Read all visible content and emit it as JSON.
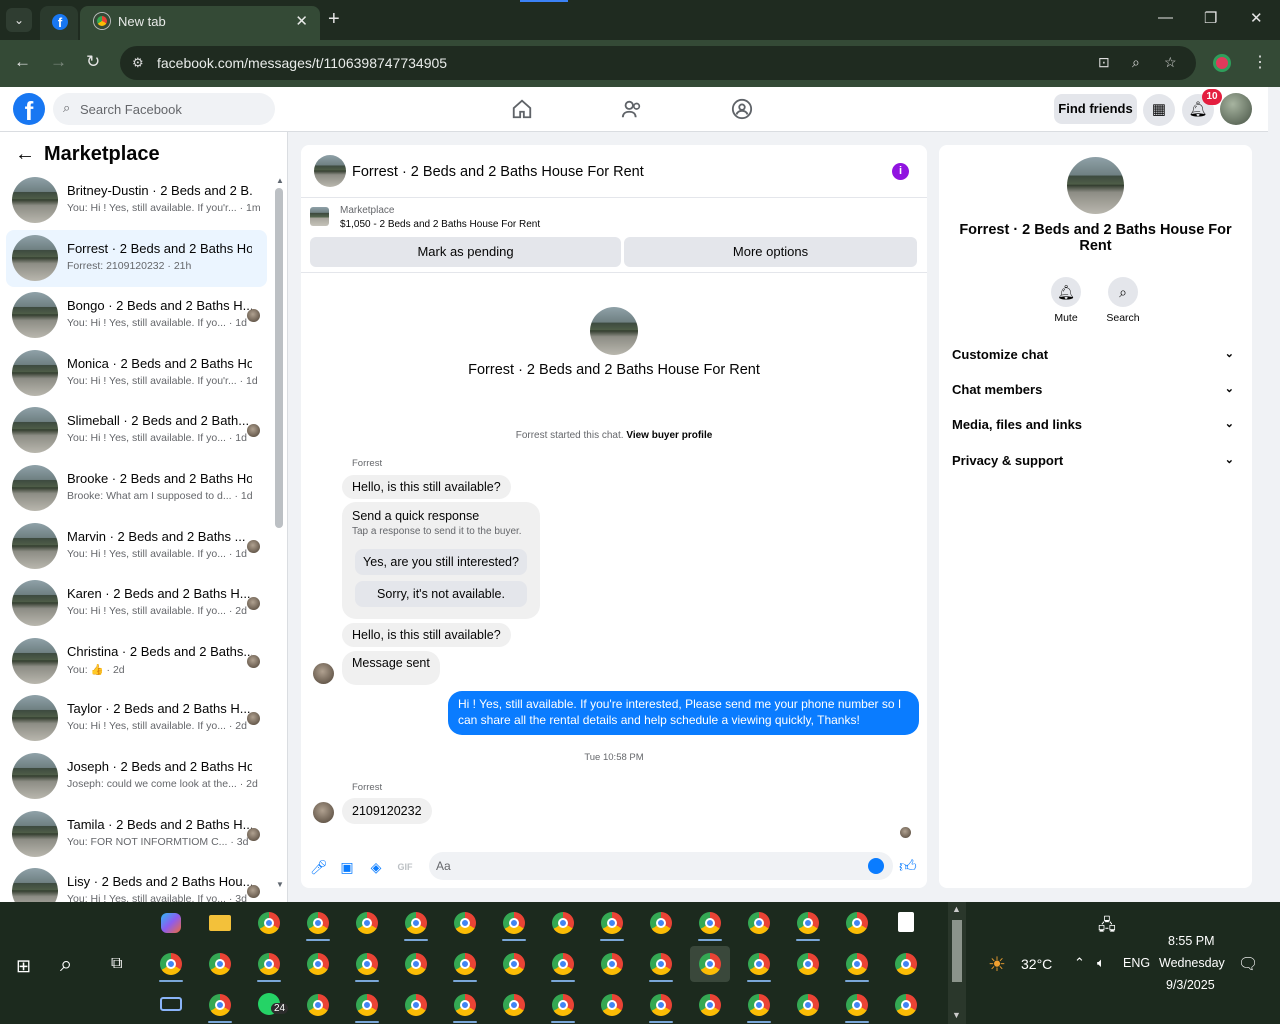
{
  "browser": {
    "tabs": [
      {
        "label": "",
        "icon": "facebook-icon"
      },
      {
        "label": "New tab",
        "icon": "chrome-icon"
      }
    ],
    "url": "facebook.com/messages/t/1106398747734905"
  },
  "fb_nav": {
    "search_placeholder": "Search Facebook",
    "find_friends": "Find friends",
    "notifications_count": "10"
  },
  "left_panel": {
    "title": "Marketplace",
    "conversations": [
      {
        "name": "Britney-Dustin · 2 Beds and 2 B...",
        "preview": "You: Hi ! Yes, still available. If you'r... · 1m"
      },
      {
        "name": "Forrest · 2 Beds and 2 Baths Ho...",
        "preview": "Forrest: 2109120232 · 21h"
      },
      {
        "name": "Bongo · 2 Beds and 2 Baths H...",
        "preview": "You: Hi ! Yes, still available. If yo... · 1d"
      },
      {
        "name": "Monica · 2 Beds and 2 Baths Ho...",
        "preview": "You: Hi ! Yes, still available. If you'r... · 1d"
      },
      {
        "name": "Slimeball · 2 Beds and 2 Bath...",
        "preview": "You: Hi ! Yes, still available. If yo... · 1d"
      },
      {
        "name": "Brooke · 2 Beds and 2 Baths Ho...",
        "preview": "Brooke: What am I supposed to d... · 1d"
      },
      {
        "name": "Marvin · 2 Beds and 2 Baths ...",
        "preview": "You: Hi ! Yes, still available. If yo... · 1d"
      },
      {
        "name": "Karen · 2 Beds and 2 Baths H...",
        "preview": "You: Hi ! Yes, still available. If yo... · 2d"
      },
      {
        "name": "Christina · 2 Beds and 2 Baths...",
        "preview": "You: 👍 · 2d"
      },
      {
        "name": "Taylor · 2 Beds and 2 Baths H...",
        "preview": "You: Hi ! Yes, still available. If yo... · 2d"
      },
      {
        "name": "Joseph · 2 Beds and 2 Baths Ho...",
        "preview": "Joseph: could we come look at the... · 2d"
      },
      {
        "name": "Tamila · 2 Beds and 2 Baths H...",
        "preview": "You: FOR NOT INFORMTIOM C... · 3d"
      },
      {
        "name": "Lisy · 2 Beds and 2 Baths Hou...",
        "preview": "You: Hi ! Yes, still available. If yo... · 3d"
      }
    ]
  },
  "chat": {
    "title": "Forrest · 2 Beds and 2 Baths House For Rent",
    "marketplace_label": "Marketplace",
    "listing": "$1,050 - 2 Beds and 2 Baths House For Rent",
    "mark_pending": "Mark as pending",
    "more_options": "More options",
    "center_name": "Forrest · 2 Beds and 2 Baths House For Rent",
    "started_text": "Forrest started this chat.",
    "view_profile": "View buyer profile",
    "sender_name": "Forrest",
    "msg1": "Hello, is this still available?",
    "quick_title": "Send a quick response",
    "quick_sub": "Tap a response to send it to the buyer.",
    "quick_opt1": "Yes, are you still interested?",
    "quick_opt2": "Sorry, it's not available.",
    "msg2": "Hello, is this still available?",
    "msg3": "Message sent",
    "outgoing": "Hi ! Yes, still available. If you're interested, Please send me your phone number so I can share all the rental details and help schedule a viewing quickly, Thanks!",
    "timestamp": "Tue 10:58 PM",
    "sender_name2": "Forrest",
    "msg4": "2109120232",
    "input_placeholder": "Aa"
  },
  "right_panel": {
    "name": "Forrest · 2 Beds and 2 Baths House For Rent",
    "mute": "Mute",
    "search": "Search",
    "sections": [
      "Customize chat",
      "Chat members",
      "Media, files and links",
      "Privacy & support"
    ]
  },
  "taskbar": {
    "weather": "32°C",
    "lang": "ENG",
    "time": "8:55 PM",
    "day": "Wednesday",
    "date": "9/3/2025",
    "whatsapp_badge": "24"
  },
  "colors": {
    "brand": "#1877f2",
    "outgoing_bubble": "#0a7cff",
    "info": "#9013e0"
  }
}
